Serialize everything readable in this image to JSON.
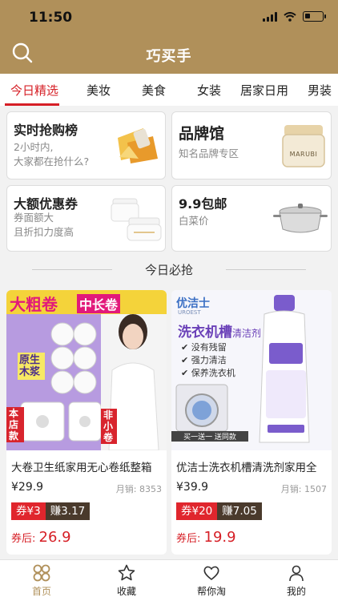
{
  "status": {
    "time": "11:50"
  },
  "nav": {
    "title": "巧买手"
  },
  "tabs": [
    "今日精选",
    "美妆",
    "美食",
    "女装",
    "居家日用",
    "男装"
  ],
  "promos": [
    {
      "title": "实时抢购榜",
      "line1": "2小时内,",
      "line2": "大家都在抢什么?"
    },
    {
      "title": "品牌馆",
      "line1": "知名品牌专区",
      "line2": ""
    },
    {
      "title": "大额优惠券",
      "line1": "券面额大",
      "line2": "且折扣力度高"
    },
    {
      "title": "9.9包邮",
      "line1": "白菜价",
      "line2": ""
    }
  ],
  "brand_logo_text": "MARUBI",
  "section_title": "今日必抢",
  "products": [
    {
      "title": "大卷卫生纸家用无心卷纸整箱",
      "price": "¥29.9",
      "sales": "月销: 8353",
      "coupon": "券¥3",
      "earn": "赚3.17",
      "after_label": "券后: ",
      "after_price": "26.9",
      "img_banner": "大粗卷",
      "img_banner2": "中长卷",
      "img_tag1": "原生木浆",
      "img_tag2": "本店款",
      "img_tag3": "非小卷"
    },
    {
      "title": "优洁士洗衣机槽清洗剂家用全",
      "price": "¥39.9",
      "sales": "月销: 1507",
      "coupon": "券¥20",
      "earn": "赚7.05",
      "after_label": "券后: ",
      "after_price": "19.9",
      "img_brand": "优洁士",
      "img_brand_en": "UROEST",
      "img_headline": "洗衣机槽",
      "img_headline2": "清洁剂",
      "img_points": [
        "没有残留",
        "强力清洁",
        "保养洗衣机"
      ],
      "img_deal": "买一送一 送同款"
    }
  ],
  "bottom_tabs": [
    "首页",
    "收藏",
    "帮你淘",
    "我的"
  ],
  "colors": {
    "header": "#b0905a",
    "accent": "#d61f26"
  }
}
